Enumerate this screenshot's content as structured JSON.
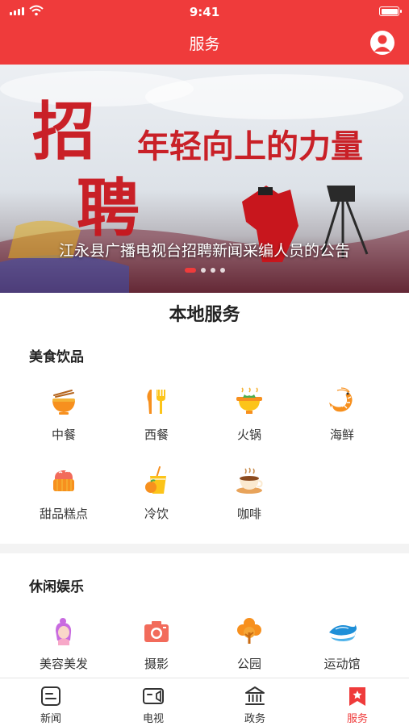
{
  "status_bar": {
    "time": "9:41"
  },
  "header": {
    "title": "服务"
  },
  "banner": {
    "caption": "江永县广播电视台招聘新闻采编人员的公告",
    "art_text_left": "招聘",
    "art_text_right": "年轻向上的力量",
    "dots": 4,
    "active_dot": 0
  },
  "section_title": "本地服务",
  "categories": [
    {
      "title": "美食饮品",
      "items": [
        {
          "label": "中餐",
          "icon": "noodle-bowl-icon"
        },
        {
          "label": "西餐",
          "icon": "fork-knife-icon"
        },
        {
          "label": "火锅",
          "icon": "hotpot-icon"
        },
        {
          "label": "海鲜",
          "icon": "shrimp-icon"
        },
        {
          "label": "甜品糕点",
          "icon": "cake-icon"
        },
        {
          "label": "冷饮",
          "icon": "cold-drink-icon"
        },
        {
          "label": "咖啡",
          "icon": "coffee-icon"
        }
      ]
    },
    {
      "title": "休闲娱乐",
      "items": [
        {
          "label": "美容美发",
          "icon": "beauty-icon"
        },
        {
          "label": "摄影",
          "icon": "camera-icon"
        },
        {
          "label": "公园",
          "icon": "tree-icon"
        },
        {
          "label": "运动馆",
          "icon": "wave-icon"
        }
      ]
    }
  ],
  "tabbar": {
    "items": [
      {
        "label": "新闻",
        "icon": "news-icon"
      },
      {
        "label": "电视",
        "icon": "tv-icon"
      },
      {
        "label": "政务",
        "icon": "government-icon"
      },
      {
        "label": "服务",
        "icon": "service-icon"
      }
    ],
    "active": 3
  },
  "colors": {
    "accent": "#ef3b3b",
    "orange": "#f7901e",
    "yellow": "#fcc419"
  }
}
